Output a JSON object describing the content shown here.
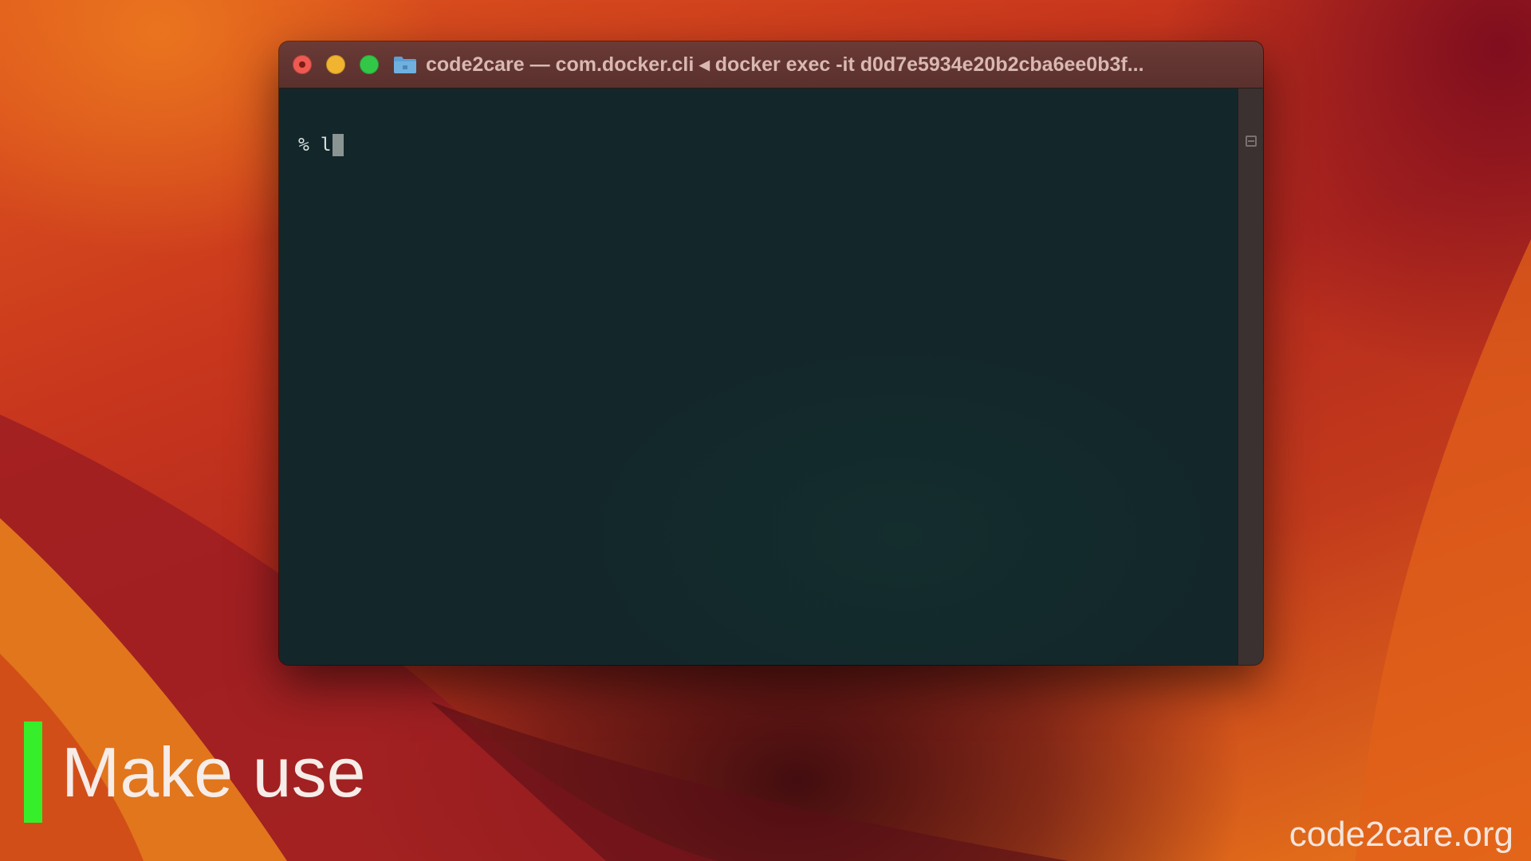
{
  "window": {
    "title": "code2care — com.docker.cli ◂ docker exec -it d0d7e5934e20b2cba6ee0b3f..."
  },
  "terminal": {
    "prompt_symbol": "%",
    "typed_text": "l"
  },
  "overlay": {
    "caption": "Make use",
    "watermark": "code2care.org"
  },
  "colors": {
    "accent_bar": "#36ee2a",
    "close": "#ee5a52",
    "minimize": "#f0b430",
    "zoom": "#33c748",
    "terminal_background": "#13272a"
  },
  "icons": {
    "title_folder": "folder-icon",
    "scroll_split": "split-pane-icon"
  }
}
